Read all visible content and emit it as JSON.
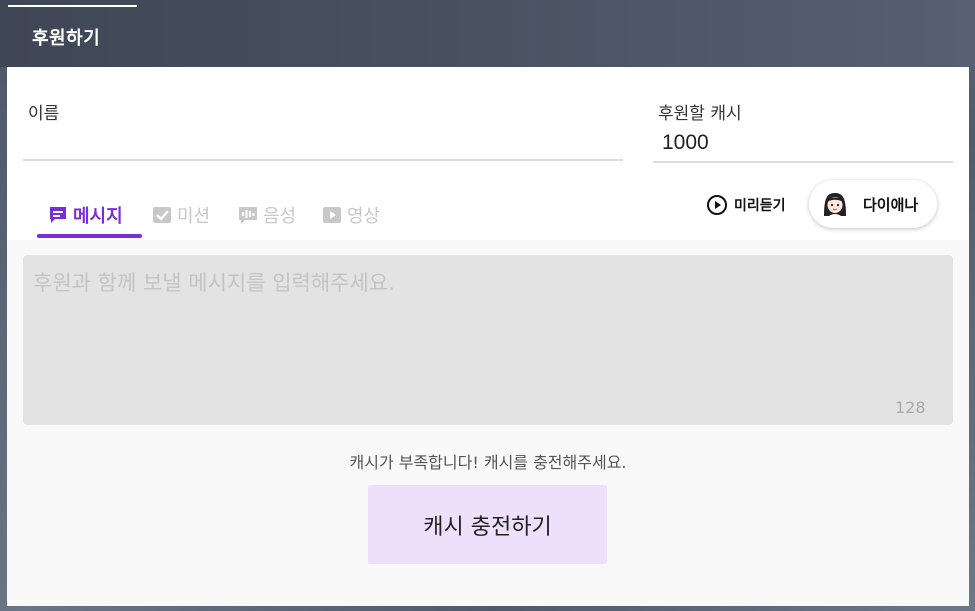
{
  "header": {
    "title": "후원하기"
  },
  "form": {
    "name_label": "이름",
    "name_value": "",
    "cash_label": "후원할 캐시",
    "cash_value": "1000"
  },
  "tabs": [
    {
      "label": "메시지",
      "icon": "message-icon",
      "active": true
    },
    {
      "label": "미션",
      "icon": "mission-check-icon",
      "active": false
    },
    {
      "label": "음성",
      "icon": "voice-icon",
      "active": false
    },
    {
      "label": "영상",
      "icon": "video-play-icon",
      "active": false
    }
  ],
  "preview": {
    "label": "미리듣기",
    "icon": "play-circle-icon"
  },
  "voice": {
    "name": "다이애나",
    "icon": "avatar-girl-icon"
  },
  "message": {
    "placeholder": "후원과 함께 보낼 메시지를 입력해주세요.",
    "value": "",
    "char_count": "128"
  },
  "notice": "캐시가 부족합니다! 캐시를 충전해주세요.",
  "charge_button": "캐시 충전하기",
  "colors": {
    "accent": "#7a2ed6",
    "charge_button_bg": "#eee0fb",
    "header_bg": "#4a5262",
    "message_box_bg": "#e3e3e3"
  }
}
